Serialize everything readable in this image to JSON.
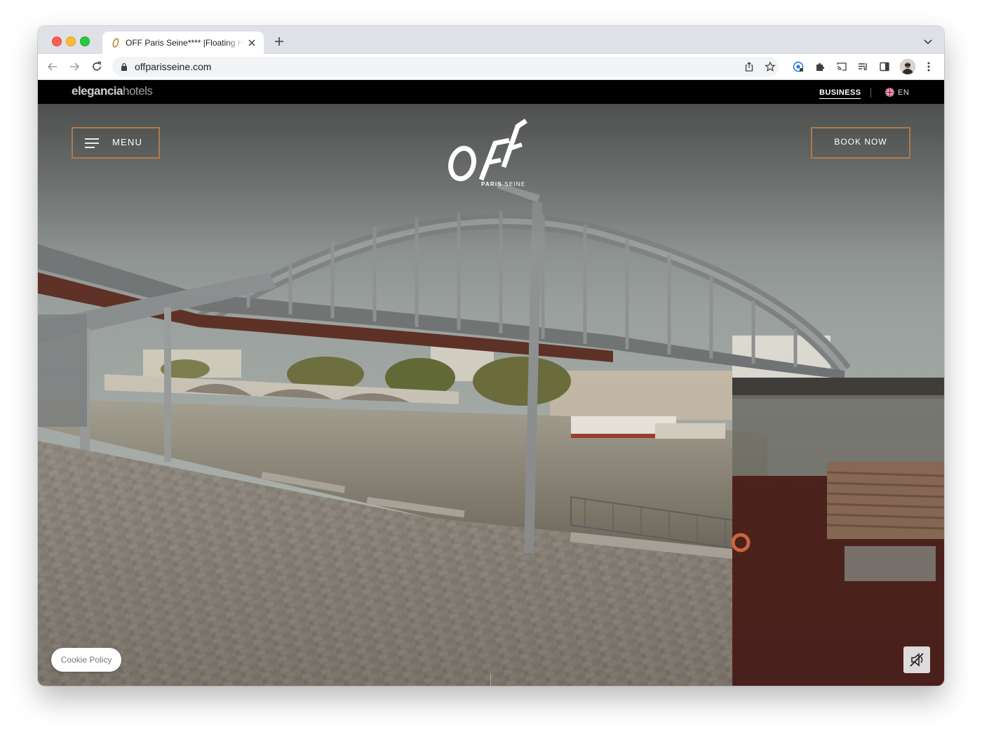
{
  "browser": {
    "tab_title": "OFF Paris Seine**** |Floating H",
    "url": "offparisseine.com",
    "icons": [
      "back-arrow-icon",
      "forward-arrow-icon",
      "reload-icon",
      "lock-icon",
      "share-icon",
      "star-icon",
      "extension-icon",
      "puzzle-icon",
      "cast-icon",
      "reading-list-icon",
      "side-panel-icon",
      "profile-avatar",
      "kebab-menu-icon",
      "tab-close-icon",
      "new-tab-icon",
      "tab-search-icon"
    ]
  },
  "site": {
    "brand_bold": "elegancia",
    "brand_light": "hotels",
    "business_label": "BUSINESS",
    "lang_code": "EN",
    "menu_label": "MENU",
    "book_label": "BOOK NOW",
    "logo_text": "OFF",
    "logo_sub_bold": "PARIS",
    "logo_sub_light": "SEINE",
    "cookie_label": "Cookie Policy",
    "accent_color": "#b07a4a"
  }
}
